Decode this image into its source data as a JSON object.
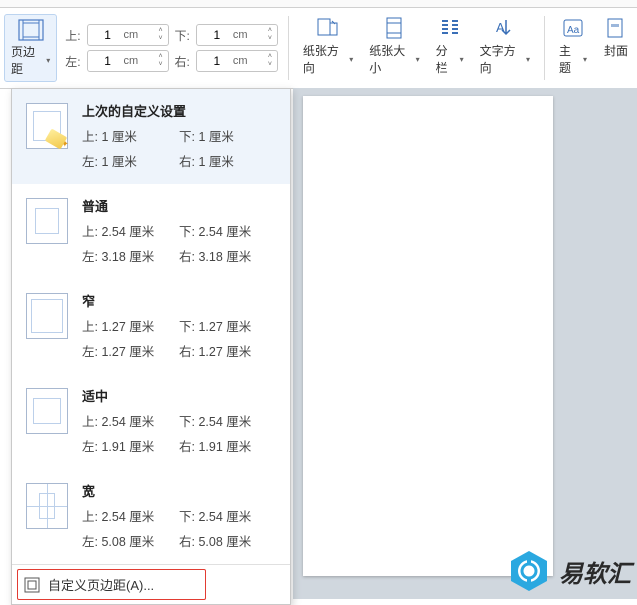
{
  "ribbon": {
    "margin_button_label": "页边距",
    "inputs": {
      "top_label": "上:",
      "top_value": "1",
      "bottom_label": "下:",
      "bottom_value": "1",
      "left_label": "左:",
      "left_value": "1",
      "right_label": "右:",
      "right_value": "1",
      "unit": "cm"
    },
    "orientation_label": "纸张方向",
    "size_label": "纸张大小",
    "columns_label": "分栏",
    "text_direction_label": "文字方向",
    "theme_label": "主题",
    "cover_label": "封面"
  },
  "dropdown": {
    "items": [
      {
        "title": "上次的自定义设置",
        "top": "上: 1 厘米",
        "bottom": "下: 1 厘米",
        "left": "左: 1 厘米",
        "right": "右: 1 厘米",
        "thumb": "custom",
        "selected": true
      },
      {
        "title": "普通",
        "top": "上: 2.54 厘米",
        "bottom": "下: 2.54 厘米",
        "left": "左: 3.18 厘米",
        "right": "右: 3.18 厘米",
        "thumb": "normal"
      },
      {
        "title": "窄",
        "top": "上: 1.27 厘米",
        "bottom": "下: 1.27 厘米",
        "left": "左: 1.27 厘米",
        "right": "右: 1.27 厘米",
        "thumb": "narrow"
      },
      {
        "title": "适中",
        "top": "上: 2.54 厘米",
        "bottom": "下: 2.54 厘米",
        "left": "左: 1.91 厘米",
        "right": "右: 1.91 厘米",
        "thumb": "moderate"
      },
      {
        "title": "宽",
        "top": "上: 2.54 厘米",
        "bottom": "下: 2.54 厘米",
        "left": "左: 5.08 厘米",
        "right": "右: 5.08 厘米",
        "thumb": "wide"
      }
    ],
    "custom_label": "自定义页边距(A)..."
  },
  "watermark": {
    "text": "易软汇"
  }
}
